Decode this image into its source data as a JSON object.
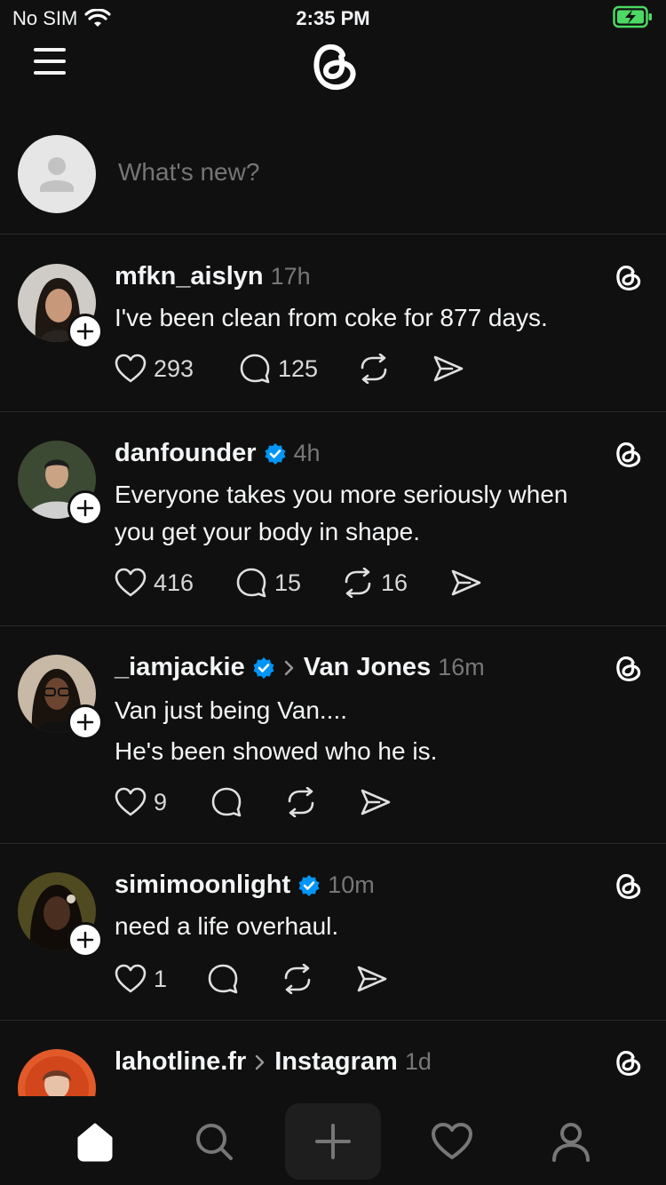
{
  "status": {
    "carrier": "No SIM",
    "time": "2:35 PM"
  },
  "composer": {
    "placeholder": "What's new?"
  },
  "posts": [
    {
      "username": "mfkn_aislyn",
      "verified": false,
      "time": "17h",
      "lines": [
        "I've been clean from coke for 877 days."
      ],
      "likes": "293",
      "replies": "125",
      "reposts": ""
    },
    {
      "username": "danfounder",
      "verified": true,
      "time": "4h",
      "lines": [
        "Everyone takes you more seriously when",
        "you get your body in shape."
      ],
      "likes": "416",
      "replies": "15",
      "reposts": "16"
    },
    {
      "username": "_iamjackie",
      "verified": true,
      "reply_to": "Van Jones",
      "time": "16m",
      "lines": [
        "Van just being Van....",
        "He's been showed who he is."
      ],
      "likes": "9",
      "replies": "",
      "reposts": ""
    },
    {
      "username": "simimoonlight",
      "verified": true,
      "time": "10m",
      "lines": [
        "need a life overhaul."
      ],
      "likes": "1",
      "replies": "",
      "reposts": ""
    },
    {
      "username": "lahotline.fr",
      "verified": false,
      "reply_to": "Instagram",
      "time": "1d",
      "lines": []
    }
  ],
  "nav": [
    "home-icon",
    "search-icon",
    "compose-icon",
    "heart-icon",
    "profile-icon"
  ],
  "colors": {
    "background": "#101010",
    "verified": "#0095f6",
    "text": "#f3f5f7",
    "muted": "#777777",
    "divider": "#2b2b2b"
  }
}
